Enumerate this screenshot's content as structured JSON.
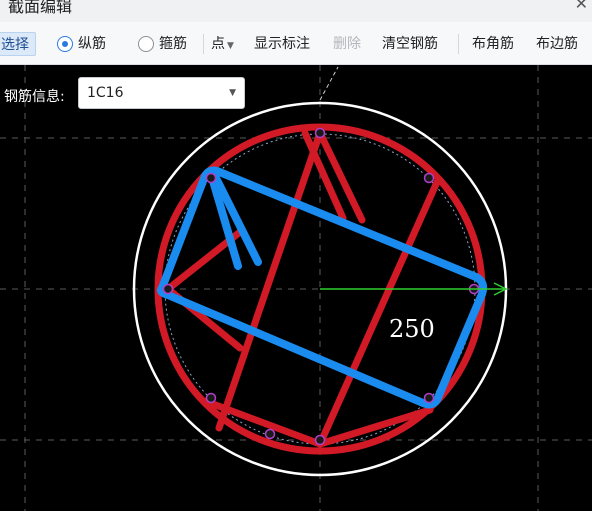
{
  "window": {
    "title": "截面编辑",
    "close_icon": "close-icon"
  },
  "toolbar": {
    "select_label": "选择",
    "radio_longitudinal": "纵筋",
    "radio_stirrup": "箍筋",
    "point_dropdown": "点",
    "show_label": "显示标注",
    "delete_label": "删除",
    "clear_label": "清空钢筋",
    "corner_label": "布角筋",
    "edge_label": "布边筋"
  },
  "rebar_info": {
    "label": "钢筋信息:",
    "value": "1C16"
  },
  "canvas": {
    "dimension_label": "250"
  },
  "colors": {
    "rebar_red": "#d11a26",
    "stirrup_blue": "#1a8cf0",
    "outline": "#ffffff",
    "dim_green": "#2fd02f",
    "marker": "#b040c8"
  }
}
